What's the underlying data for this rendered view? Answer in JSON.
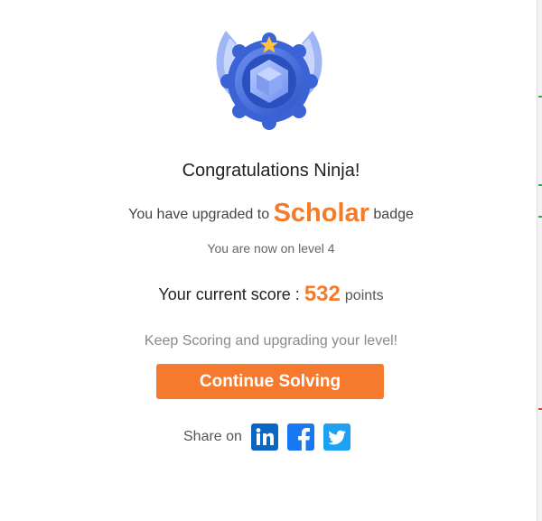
{
  "modal": {
    "title": "Congratulations Ninja!",
    "upgrade": {
      "prefix": "You have upgraded to",
      "badge_name": "Scholar",
      "suffix": "badge"
    },
    "level_text": "You are now on level 4",
    "score": {
      "label": "Your current score :",
      "value": "532",
      "unit": "points"
    },
    "encouragement": "Keep Scoring and upgrading your level!",
    "continue_label": "Continue Solving",
    "share": {
      "label": "Share on",
      "networks": [
        "linkedin-icon",
        "facebook-icon",
        "twitter-icon"
      ]
    }
  },
  "colors": {
    "accent": "#f67a2e",
    "linkedin": "#0a66c2",
    "facebook": "#1877f2",
    "twitter": "#1da1f2",
    "badge_blue": "#3b63d6"
  },
  "icons": {
    "badge": "scholar-badge-icon",
    "star": "star-icon"
  }
}
